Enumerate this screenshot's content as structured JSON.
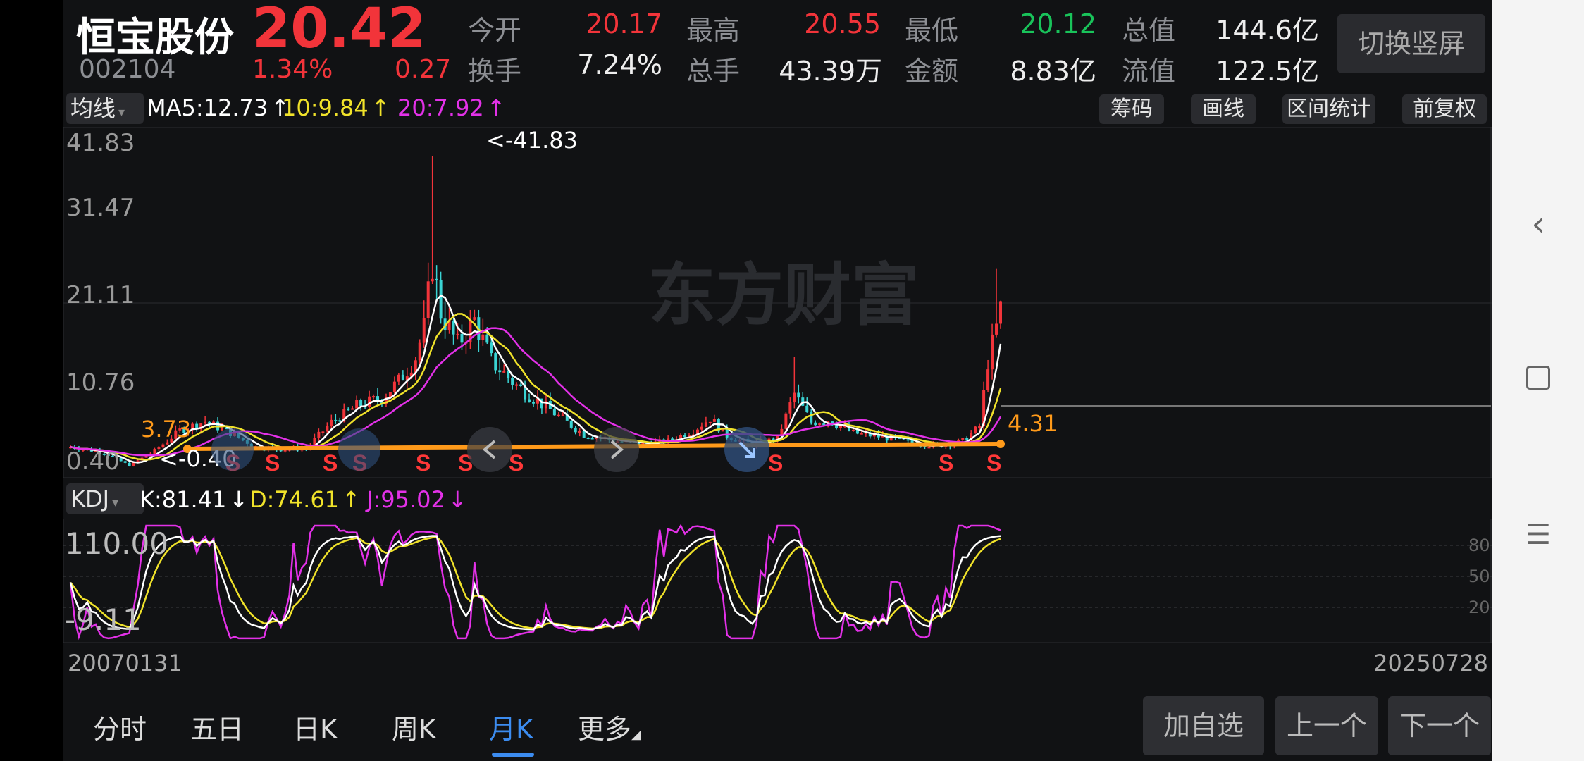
{
  "stock": {
    "name": "恒宝股份",
    "code": "002104",
    "price": "20.42",
    "change_pct": "1.34%",
    "change": "0.27"
  },
  "quote": {
    "open_label": "今开",
    "open": "20.17",
    "high_label": "最高",
    "high": "20.55",
    "low_label": "最低",
    "low": "20.12",
    "mcap_label": "总值",
    "mcap": "144.6亿",
    "turnover_label": "换手",
    "turnover": "7.24%",
    "volume_label": "总手",
    "volume": "43.39万",
    "amount_label": "金额",
    "amount": "8.83亿",
    "float_label": "流值",
    "float": "122.5亿"
  },
  "switch_button": "切换竖屏",
  "ma_bar": {
    "select": "均线",
    "ma5": "MA5:12.73",
    "ma10": "10:9.84",
    "ma20": "20:7.92",
    "arrow_up": "↑"
  },
  "tools": [
    "筹码",
    "画线",
    "区间统计",
    "前复权"
  ],
  "main_chart": {
    "y_labels": [
      "41.83",
      "31.47",
      "21.11",
      "10.76",
      "0.40"
    ],
    "max_marker": "<-41.83",
    "min_marker": "<-0.40",
    "left_line_value": "3.73",
    "right_line_value": "4.31",
    "watermark": "东方财富",
    "s_mark": "S"
  },
  "kdj_bar": {
    "select": "KDJ",
    "k": "K:81.41",
    "d": "D:74.61",
    "j": "J:95.02",
    "arrow_down": "↓",
    "arrow_up": "↑"
  },
  "kdj_chart": {
    "y_top": "110.00",
    "y_bottom": "-9.11",
    "levels": [
      "80",
      "50",
      "20"
    ]
  },
  "dates": {
    "start": "20070131",
    "end": "20250728"
  },
  "period_tabs": [
    {
      "label": "分时",
      "active": false
    },
    {
      "label": "五日",
      "active": false
    },
    {
      "label": "日K",
      "active": false
    },
    {
      "label": "周K",
      "active": false
    },
    {
      "label": "月K",
      "active": true
    },
    {
      "label": "更多",
      "active": false
    }
  ],
  "actions": [
    "加自选",
    "上一个",
    "下一个"
  ],
  "colors": {
    "up": "#f2343a",
    "down": "#3ad4d4",
    "ma5": "#ffffff",
    "ma10": "#f0e22a",
    "ma20": "#e331e8",
    "trendline": "#ff9a1a",
    "active_tab": "#3c8cf0"
  },
  "nav_icons": [
    "back-chevron-icon",
    "square-icon",
    "menu-icon"
  ]
}
